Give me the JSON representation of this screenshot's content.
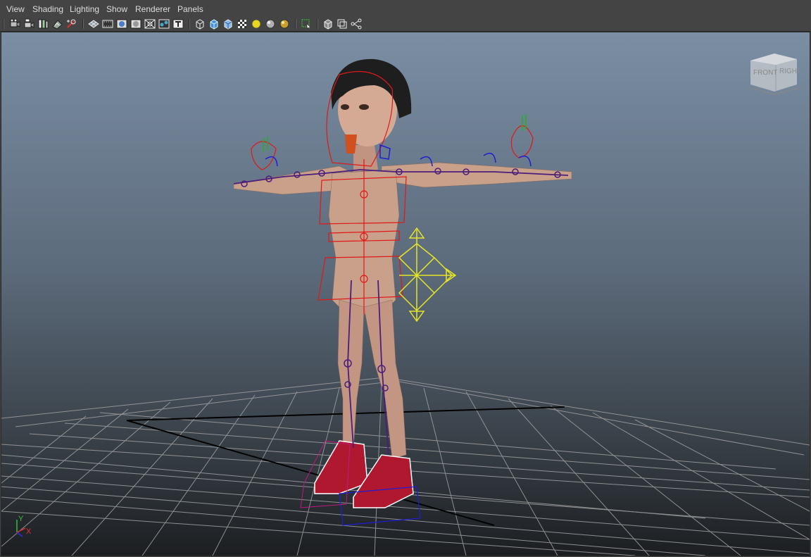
{
  "menu": {
    "items": [
      {
        "id": "view",
        "label": "View"
      },
      {
        "id": "shading",
        "label": "Shading"
      },
      {
        "id": "lighting",
        "label": "Lighting"
      },
      {
        "id": "show",
        "label": "Show"
      },
      {
        "id": "renderer",
        "label": "Renderer"
      },
      {
        "id": "panels",
        "label": "Panels"
      }
    ]
  },
  "toolbar": {
    "icons": [
      "select-camera-icon",
      "camera-attributes-icon",
      "bookmarks-icon",
      "image-plane-icon",
      "two-d-pan-zoom-icon",
      "grid-toggle-icon",
      "film-gate-icon",
      "resolution-gate-icon",
      "gate-mask-icon",
      "field-chart-icon",
      "safe-action-icon",
      "safe-title-icon",
      "wireframe-icon",
      "smooth-shade-icon",
      "flat-shade-icon",
      "textured-icon",
      "use-all-lights-icon",
      "shadows-icon",
      "screen-space-ao-icon",
      "isolate-select-icon",
      "xray-icon",
      "xray-active-components-icon",
      "xray-joints-icon"
    ]
  },
  "viewcube": {
    "front_label": "FRONT",
    "right_label": "RIGHT"
  },
  "axis_indicator": {
    "y_label": "Y",
    "x_label": "X"
  },
  "colors": {
    "menu_bg": "#444444",
    "menu_text": "#dcdcdc",
    "viewport_top": "#7b8ea4",
    "viewport_bottom": "#1c1e21",
    "grid": "#a0a0a0",
    "grid_axis": "#000000",
    "ik_control": "#1e1ed2",
    "fk_control": "#e01818",
    "joint": "#4a1e7a",
    "move_manip": "#e6e622",
    "skin": "#c9a08a",
    "hair": "#1e1e1e",
    "shoe": "#b01830"
  }
}
